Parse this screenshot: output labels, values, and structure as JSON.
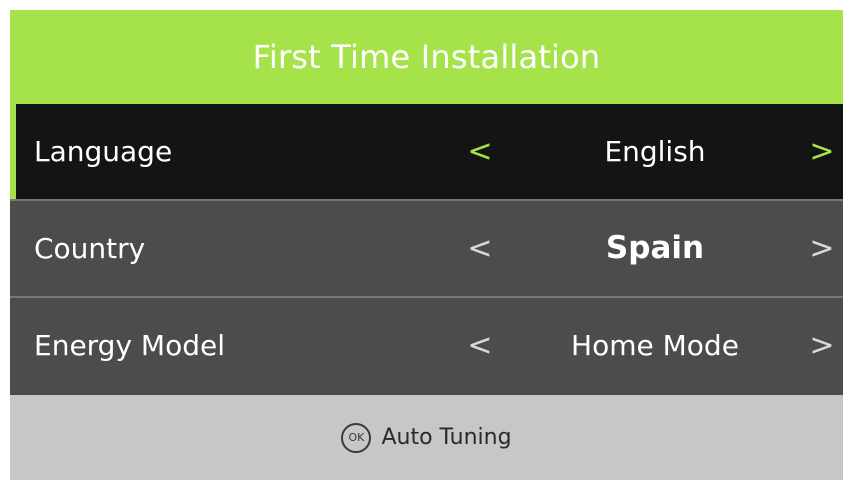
{
  "header": {
    "title": "First Time Installation"
  },
  "settings": [
    {
      "label": "Language",
      "value": "English",
      "selected": true
    },
    {
      "label": "Country",
      "value": "Spain",
      "selected": false
    },
    {
      "label": "Energy Model",
      "value": "Home Mode",
      "selected": false
    }
  ],
  "arrows": {
    "left": "<",
    "right": ">"
  },
  "footer": {
    "ok_icon_text": "OK",
    "action_label": "Auto Tuning"
  },
  "colors": {
    "accent": "#a6e34a",
    "selected_row_bg": "#141414",
    "row_bg": "#4c4c4c",
    "footer_bg": "#c7c7c7"
  },
  "icons": {
    "ok": "ok-button-icon"
  }
}
